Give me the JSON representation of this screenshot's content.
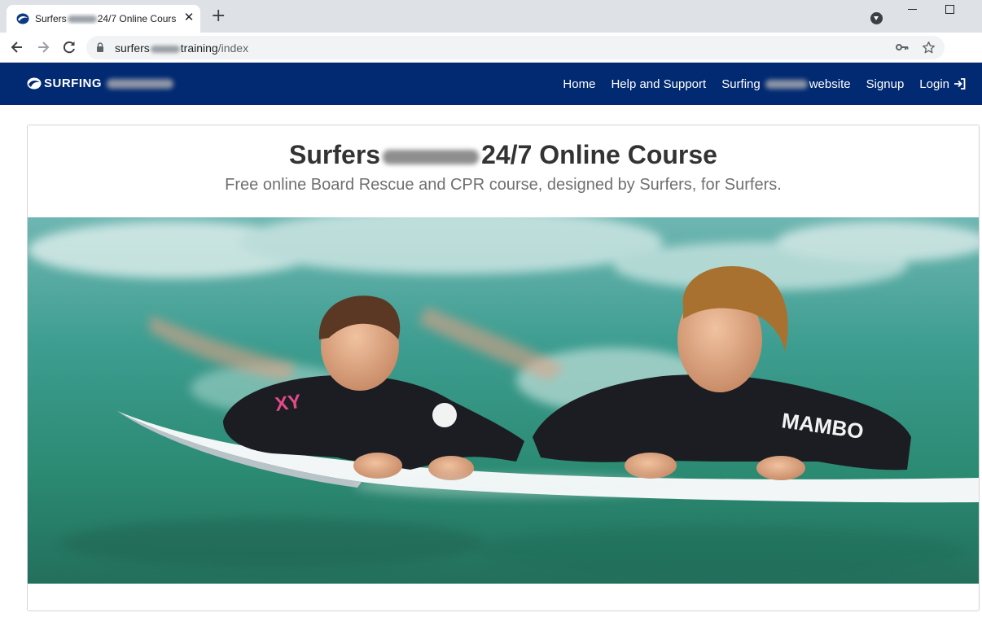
{
  "browser": {
    "tab_title_prefix": "Surfers",
    "tab_title_suffix": "24/7 Online Cours",
    "url_host_prefix": "surfers",
    "url_host_suffix": "training",
    "url_path": "/index"
  },
  "site": {
    "logo_text": "SURFING",
    "nav": {
      "home": "Home",
      "help": "Help and Support",
      "surfing_prefix": "Surfing",
      "surfing_suffix": "website",
      "signup": "Signup",
      "login": "Login"
    }
  },
  "hero": {
    "title_prefix": "Surfers",
    "title_suffix": "24/7 Online Course",
    "subtitle": "Free online Board Rescue and CPR course, designed by Surfers, for Surfers.",
    "image_text_left": "XY",
    "image_text_right": "MAMBO"
  },
  "colors": {
    "nav_bg": "#022a72",
    "water": "#3e9a8c",
    "wetsuit": "#1b1d22"
  },
  "icons": [
    "favicon",
    "close-icon",
    "plus-icon",
    "profile-icon",
    "minimize-icon",
    "maximize-icon",
    "back-icon",
    "forward-icon",
    "reload-icon",
    "lock-icon",
    "key-icon",
    "star-icon",
    "logo-icon",
    "login-icon"
  ]
}
